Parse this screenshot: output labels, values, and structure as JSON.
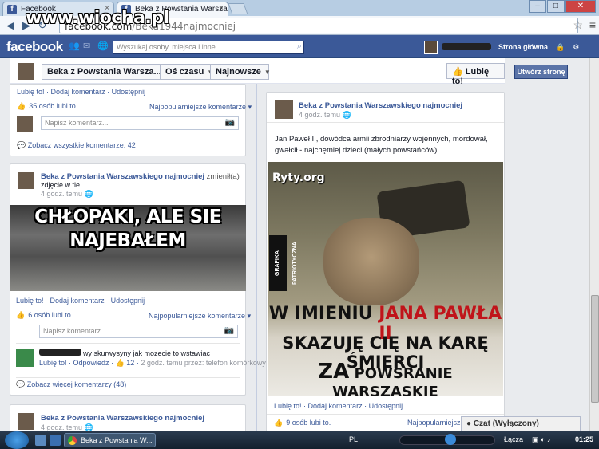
{
  "browser": {
    "tabs": [
      {
        "label": "Facebook",
        "close": "×"
      },
      {
        "label": "Beka z Powstania Warsza",
        "close": "×"
      }
    ],
    "url_host": "facebook.com",
    "url_path": "/Beka1944najmocniej",
    "watermark": "www.wiocha.pl"
  },
  "facebook": {
    "logo": "facebook",
    "search_placeholder": "Wyszukaj osoby, miejsca i inne",
    "home_link": "Strona główna",
    "icons": [
      "friend-requests-icon",
      "messages-icon",
      "notifications-icon",
      "privacy-icon",
      "settings-icon"
    ]
  },
  "page_header": {
    "page_name": "Beka z Powstania Warsza...",
    "timeline_filter": "Oś czasu",
    "sort": "Najnowsze",
    "like_button": "Lubię to!",
    "create_page": "Utwórz stronę"
  },
  "post1": {
    "actions": [
      "Lubię to!",
      "Dodaj komentarz",
      "Udostępnij"
    ],
    "likes": "35 osób lubi to.",
    "sort": "Najpopularniejsze komentarze",
    "comment_placeholder": "Napisz komentarz...",
    "view_all": "Zobacz wszystkie komentarze: 42"
  },
  "post2": {
    "author": "Beka z Powstania Warszawskiego najmocniej",
    "author_suffix": "zmienił(a)",
    "story": "zdjęcie w tle.",
    "time": "4 godz. temu",
    "image_text_1": "CHŁOPAKI, ALE SIE",
    "image_text_2": "NAJEBAŁEM",
    "actions": [
      "Lubię to!",
      "Dodaj komentarz",
      "Udostępnij"
    ],
    "likes": "6 osób lubi to.",
    "sort": "Najpopularniejsze komentarze",
    "comment_placeholder": "Napisz komentarz...",
    "comment": {
      "text": "wy skurwysyny jak mozecie to wstawiac",
      "like": "Lubię to!",
      "reply": "Odpowiedz",
      "likes": "12",
      "time": "2 godz. temu przez: telefon komórkowy"
    },
    "more_comments": "Zobacz więcej komentarzy (48)"
  },
  "post3": {
    "author": "Beka z Powstania Warszawskiego najmocniej",
    "time": "4 godz. temu"
  },
  "main_post": {
    "author": "Beka z Powstania Warszawskiego najmocniej",
    "time": "4 godz. temu",
    "text": "Jan Paweł II, dowódca armii zbrodniarzy wojennych, mordował, gwałcił - najchętniej dzieci (małych powstańców).",
    "image": {
      "brand": "Ryty.org",
      "side_label": "GRAFIKA PATRIOTYCZNA",
      "line1_a": "W IMIENIU",
      "line1_b": "JANA PAWŁA II",
      "line2": "SKAZUJĘ CIĘ NA KARĘ ŚMIERCI",
      "line3_a": "ZA",
      "line3_b": "POWSRANIE WARSZASKIE"
    },
    "actions": [
      "Lubię to!",
      "Dodaj komentarz",
      "Udostępnij"
    ],
    "likes": "9 osób lubi to.",
    "sort": "Najpopularniejsze kom"
  },
  "chat": {
    "label": "Czat (Wyłączony)"
  },
  "taskbar": {
    "item": "Beka z Powstania W...",
    "lang": "PL",
    "connection": "Łącza",
    "time": "01:25"
  }
}
